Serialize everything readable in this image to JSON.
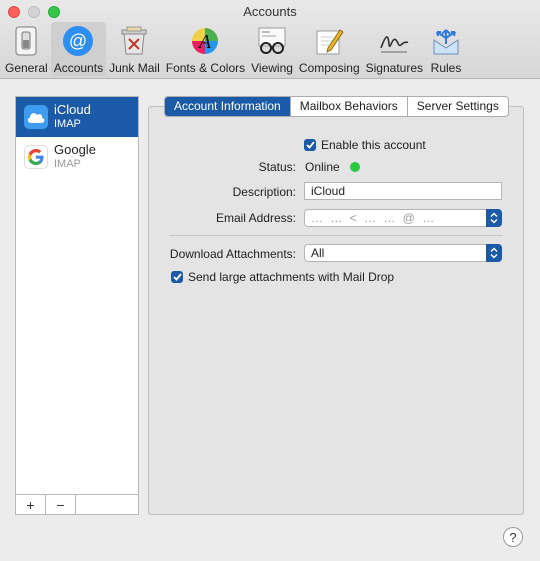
{
  "window": {
    "title": "Accounts"
  },
  "toolbar": {
    "items": [
      {
        "label": "General",
        "icon": "switch-icon"
      },
      {
        "label": "Accounts",
        "icon": "at-sign-icon"
      },
      {
        "label": "Junk Mail",
        "icon": "trash-icon"
      },
      {
        "label": "Fonts & Colors",
        "icon": "font-color-icon"
      },
      {
        "label": "Viewing",
        "icon": "glasses-icon"
      },
      {
        "label": "Composing",
        "icon": "pencil-paper-icon"
      },
      {
        "label": "Signatures",
        "icon": "signature-icon"
      },
      {
        "label": "Rules",
        "icon": "rules-arrows-icon"
      }
    ],
    "active_index": 1
  },
  "accounts": [
    {
      "name": "iCloud",
      "type": "IMAP",
      "icon": "icloud-icon",
      "selected": true
    },
    {
      "name": "Google",
      "type": "IMAP",
      "icon": "google-icon",
      "selected": false
    }
  ],
  "list_footer": {
    "add_label": "+",
    "remove_label": "−"
  },
  "tabs": [
    {
      "label": "Account Information",
      "active": true
    },
    {
      "label": "Mailbox Behaviors",
      "active": false
    },
    {
      "label": "Server Settings",
      "active": false
    }
  ],
  "form": {
    "enable_label": "Enable this account",
    "enable_checked": true,
    "status_label": "Status:",
    "status_value": "Online",
    "description_label": "Description:",
    "description_value": "iCloud",
    "email_label": "Email Address:",
    "email_value": "… … < … … @ …",
    "download_label": "Download Attachments:",
    "download_value": "All",
    "maildrop_label": "Send large attachments with Mail Drop",
    "maildrop_checked": true
  },
  "help_label": "?",
  "colors": {
    "accent": "#1b5aa6",
    "online": "#28c840"
  }
}
